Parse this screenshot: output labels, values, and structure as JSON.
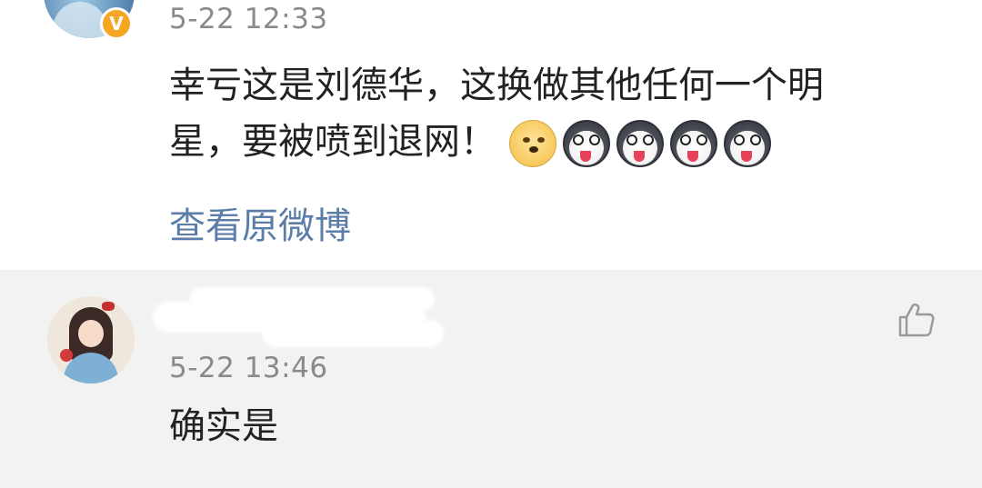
{
  "post": {
    "time": "5-22 12:33",
    "text_line1": "幸亏这是刘德华，这换做其他任何一个明",
    "text_line2": "星，要被喷到退网！",
    "emojis": [
      "doge-emoji",
      "husky-emoji",
      "husky-emoji",
      "husky-emoji",
      "husky-emoji"
    ],
    "verified_badge": "V",
    "view_original_label": "查看原微博"
  },
  "reply": {
    "username": "",
    "time": "5-22 13:46",
    "text": "确实是",
    "like_icon": "thumbs-up-icon"
  },
  "colors": {
    "link": "#5b7ea8",
    "timestamp": "#8a8a8a",
    "badge": "#f5a623",
    "reply_bg": "#f2f2f2"
  }
}
